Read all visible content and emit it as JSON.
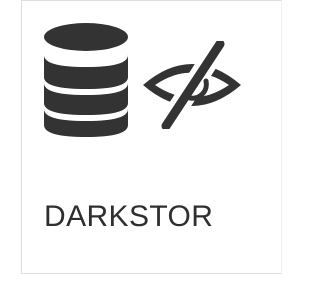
{
  "tile": {
    "label": "DARKSTOR",
    "icons": [
      "database-icon",
      "eye-slash-icon"
    ],
    "colors": {
      "icon": "#333333",
      "text": "#2f2f2f",
      "border": "#dedede",
      "background": "#ffffff"
    }
  }
}
